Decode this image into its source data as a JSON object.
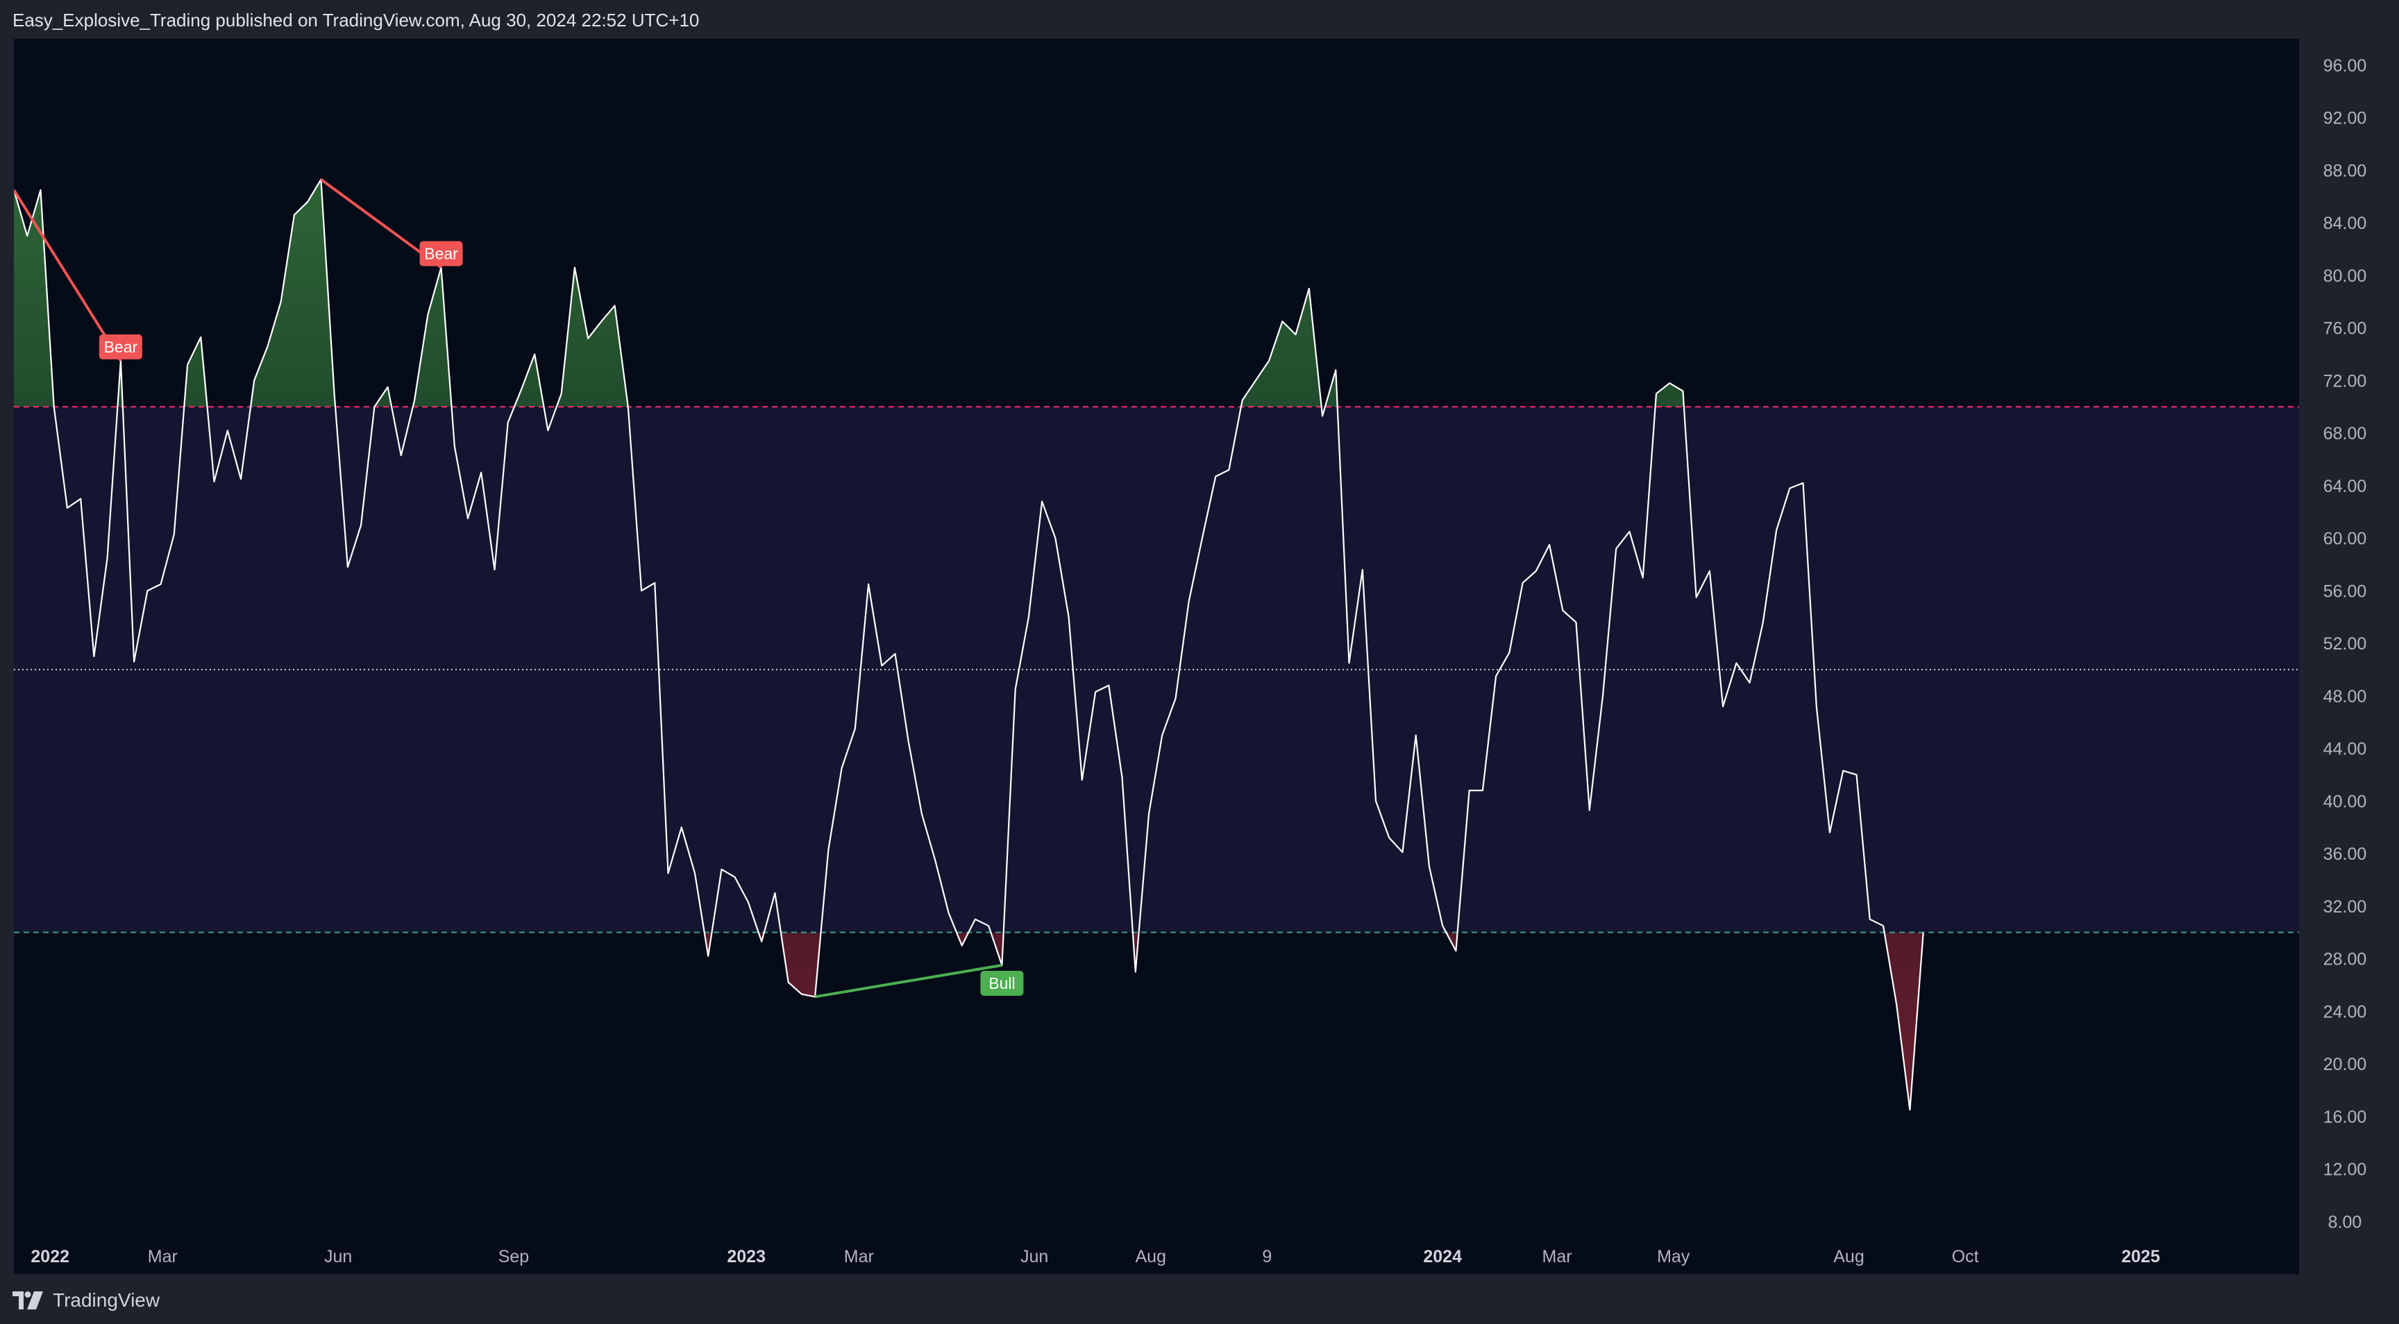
{
  "header": {
    "publish_info": "Easy_Explosive_Trading published on TradingView.com, Aug 30, 2024 22:52 UTC+10"
  },
  "footer": {
    "brand": "TradingView",
    "logo_icon": "tradingview-logo-icon"
  },
  "colors": {
    "background": "#060b18",
    "band_fill": "#141530",
    "line": "#ffffff",
    "upper_level": "#ff2a6d",
    "lower_level": "#3ca08a",
    "mid_level": "#cfd3dc",
    "bear": "#f05454",
    "bull": "#4caf50",
    "axis_text": "#b2b5be"
  },
  "chart_data": {
    "type": "line",
    "title": "",
    "xlabel": "",
    "ylabel": "",
    "ylim": [
      4,
      98
    ],
    "xlim": [
      "2021-12-13",
      "2025-03-25"
    ],
    "grid": false,
    "scale_side": "right",
    "y_ticks": [
      "96.00",
      "92.00",
      "88.00",
      "84.00",
      "80.00",
      "76.00",
      "72.00",
      "68.00",
      "64.00",
      "60.00",
      "56.00",
      "52.00",
      "48.00",
      "44.00",
      "40.00",
      "36.00",
      "32.00",
      "28.00",
      "24.00",
      "20.00",
      "16.00",
      "12.00",
      "8.00"
    ],
    "x_ticks": [
      {
        "label": "2022",
        "date": "2022-01-01",
        "bold": true
      },
      {
        "label": "Mar",
        "date": "2022-03-01",
        "bold": false
      },
      {
        "label": "Jun",
        "date": "2022-06-01",
        "bold": false
      },
      {
        "label": "Sep",
        "date": "2022-09-01",
        "bold": false
      },
      {
        "label": "2023",
        "date": "2023-01-01",
        "bold": true
      },
      {
        "label": "Mar",
        "date": "2023-03-01",
        "bold": false
      },
      {
        "label": "Jun",
        "date": "2023-06-01",
        "bold": false
      },
      {
        "label": "Aug",
        "date": "2023-08-01",
        "bold": false
      },
      {
        "label": "9",
        "date": "2023-10-01",
        "bold": false
      },
      {
        "label": "2024",
        "date": "2024-01-01",
        "bold": true
      },
      {
        "label": "Mar",
        "date": "2024-03-01",
        "bold": false
      },
      {
        "label": "May",
        "date": "2024-05-01",
        "bold": false
      },
      {
        "label": "Aug",
        "date": "2024-08-01",
        "bold": false
      },
      {
        "label": "Oct",
        "date": "2024-10-01",
        "bold": false
      },
      {
        "label": "2025",
        "date": "2025-01-01",
        "bold": true
      }
    ],
    "levels": {
      "upper": 70,
      "middle": 50,
      "lower": 30
    },
    "series": [
      {
        "values": [
          [
            "2021-12-13",
            86.5
          ],
          [
            "2021-12-20",
            83
          ],
          [
            "2021-12-27",
            86.5
          ],
          [
            "2022-01-03",
            70
          ],
          [
            "2022-01-10",
            62.3
          ],
          [
            "2022-01-17",
            63
          ],
          [
            "2022-01-24",
            51
          ],
          [
            "2022-01-31",
            58.5
          ],
          [
            "2022-02-07",
            73.5
          ],
          [
            "2022-02-14",
            50.6
          ],
          [
            "2022-02-21",
            56
          ],
          [
            "2022-02-28",
            56.5
          ],
          [
            "2022-03-07",
            60.3
          ],
          [
            "2022-03-14",
            73.2
          ],
          [
            "2022-03-21",
            75.3
          ],
          [
            "2022-03-28",
            64.3
          ],
          [
            "2022-04-04",
            68.2
          ],
          [
            "2022-04-11",
            64.5
          ],
          [
            "2022-04-18",
            72
          ],
          [
            "2022-04-25",
            74.6
          ],
          [
            "2022-05-02",
            78
          ],
          [
            "2022-05-09",
            84.6
          ],
          [
            "2022-05-16",
            85.6
          ],
          [
            "2022-05-23",
            87.3
          ],
          [
            "2022-05-30",
            71
          ],
          [
            "2022-06-06",
            57.8
          ],
          [
            "2022-06-13",
            61
          ],
          [
            "2022-06-20",
            70
          ],
          [
            "2022-06-27",
            71.5
          ],
          [
            "2022-07-04",
            66.3
          ],
          [
            "2022-07-11",
            70.5
          ],
          [
            "2022-07-18",
            77
          ],
          [
            "2022-07-25",
            80.6
          ],
          [
            "2022-08-01",
            67
          ],
          [
            "2022-08-08",
            61.5
          ],
          [
            "2022-08-15",
            65
          ],
          [
            "2022-08-22",
            57.6
          ],
          [
            "2022-08-29",
            68.8
          ],
          [
            "2022-09-05",
            71.3
          ],
          [
            "2022-09-12",
            74
          ],
          [
            "2022-09-19",
            68.2
          ],
          [
            "2022-09-26",
            71
          ],
          [
            "2022-10-03",
            80.6
          ],
          [
            "2022-10-10",
            75.2
          ],
          [
            "2022-10-17",
            76.5
          ],
          [
            "2022-10-24",
            77.7
          ],
          [
            "2022-10-31",
            70
          ],
          [
            "2022-11-07",
            56
          ],
          [
            "2022-11-14",
            56.6
          ],
          [
            "2022-11-21",
            34.5
          ],
          [
            "2022-11-28",
            38
          ],
          [
            "2022-12-05",
            34.5
          ],
          [
            "2022-12-12",
            28.2
          ],
          [
            "2022-12-19",
            34.8
          ],
          [
            "2022-12-26",
            34.2
          ],
          [
            "2023-01-02",
            32.3
          ],
          [
            "2023-01-09",
            29.3
          ],
          [
            "2023-01-16",
            33
          ],
          [
            "2023-01-23",
            26.2
          ],
          [
            "2023-01-30",
            25.3
          ],
          [
            "2023-02-06",
            25.1
          ],
          [
            "2023-02-13",
            36.3
          ],
          [
            "2023-02-20",
            42.5
          ],
          [
            "2023-02-27",
            45.5
          ],
          [
            "2023-03-06",
            56.5
          ],
          [
            "2023-03-13",
            50.3
          ],
          [
            "2023-03-20",
            51.2
          ],
          [
            "2023-03-27",
            44.5
          ],
          [
            "2023-04-03",
            39
          ],
          [
            "2023-04-10",
            35.5
          ],
          [
            "2023-04-17",
            31.5
          ],
          [
            "2023-04-24",
            29
          ],
          [
            "2023-05-01",
            31
          ],
          [
            "2023-05-08",
            30.5
          ],
          [
            "2023-05-15",
            27.5
          ],
          [
            "2023-05-22",
            48.5
          ],
          [
            "2023-05-29",
            54
          ],
          [
            "2023-06-05",
            62.8
          ],
          [
            "2023-06-12",
            60
          ],
          [
            "2023-06-19",
            54
          ],
          [
            "2023-06-26",
            41.6
          ],
          [
            "2023-07-03",
            48.3
          ],
          [
            "2023-07-10",
            48.8
          ],
          [
            "2023-07-17",
            41.8
          ],
          [
            "2023-07-24",
            27
          ],
          [
            "2023-07-31",
            39
          ],
          [
            "2023-08-07",
            45
          ],
          [
            "2023-08-14",
            47.8
          ],
          [
            "2023-08-21",
            55.2
          ],
          [
            "2023-08-28",
            60
          ],
          [
            "2023-09-04",
            64.7
          ],
          [
            "2023-09-11",
            65.2
          ],
          [
            "2023-09-18",
            70.5
          ],
          [
            "2023-09-25",
            72
          ],
          [
            "2023-10-02",
            73.5
          ],
          [
            "2023-10-09",
            76.5
          ],
          [
            "2023-10-16",
            75.5
          ],
          [
            "2023-10-23",
            79
          ],
          [
            "2023-10-30",
            69.3
          ],
          [
            "2023-11-06",
            72.8
          ],
          [
            "2023-11-13",
            50.5
          ],
          [
            "2023-11-20",
            57.6
          ],
          [
            "2023-11-27",
            40
          ],
          [
            "2023-12-04",
            37.2
          ],
          [
            "2023-12-11",
            36.1
          ],
          [
            "2023-12-18",
            45
          ],
          [
            "2023-12-25",
            35
          ],
          [
            "2024-01-01",
            30.5
          ],
          [
            "2024-01-08",
            28.6
          ],
          [
            "2024-01-15",
            40.8
          ],
          [
            "2024-01-22",
            40.8
          ],
          [
            "2024-01-29",
            49.5
          ],
          [
            "2024-02-05",
            51.3
          ],
          [
            "2024-02-12",
            56.6
          ],
          [
            "2024-02-19",
            57.5
          ],
          [
            "2024-02-26",
            59.5
          ],
          [
            "2024-03-04",
            54.5
          ],
          [
            "2024-03-11",
            53.6
          ],
          [
            "2024-03-18",
            39.3
          ],
          [
            "2024-03-25",
            48
          ],
          [
            "2024-04-01",
            59.2
          ],
          [
            "2024-04-08",
            60.5
          ],
          [
            "2024-04-15",
            57
          ],
          [
            "2024-04-22",
            71
          ],
          [
            "2024-04-29",
            71.8
          ],
          [
            "2024-05-06",
            71.2
          ],
          [
            "2024-05-13",
            55.5
          ],
          [
            "2024-05-20",
            57.5
          ],
          [
            "2024-05-27",
            47.2
          ],
          [
            "2024-06-03",
            50.5
          ],
          [
            "2024-06-10",
            49
          ],
          [
            "2024-06-17",
            53.6
          ],
          [
            "2024-06-24",
            60.6
          ],
          [
            "2024-07-01",
            63.8
          ],
          [
            "2024-07-08",
            64.2
          ],
          [
            "2024-07-15",
            47.2
          ],
          [
            "2024-07-22",
            37.6
          ],
          [
            "2024-07-29",
            42.3
          ],
          [
            "2024-08-05",
            42
          ],
          [
            "2024-08-12",
            31
          ],
          [
            "2024-08-19",
            30.5
          ],
          [
            "2024-08-26",
            24.5
          ],
          [
            "2024-09-02",
            16.5
          ],
          [
            "2024-09-09",
            30
          ]
        ]
      }
    ],
    "divergences": [
      {
        "type": "bear",
        "label": "Bear",
        "from": [
          "2021-12-13",
          86.5
        ],
        "to": [
          "2022-02-07",
          73.5
        ]
      },
      {
        "type": "bear",
        "label": "Bear",
        "from": [
          "2022-05-23",
          87.3
        ],
        "to": [
          "2022-07-25",
          80.6
        ]
      },
      {
        "type": "bull",
        "label": "Bull",
        "from": [
          "2023-02-06",
          25.1
        ],
        "to": [
          "2023-05-15",
          27.5
        ]
      }
    ]
  }
}
